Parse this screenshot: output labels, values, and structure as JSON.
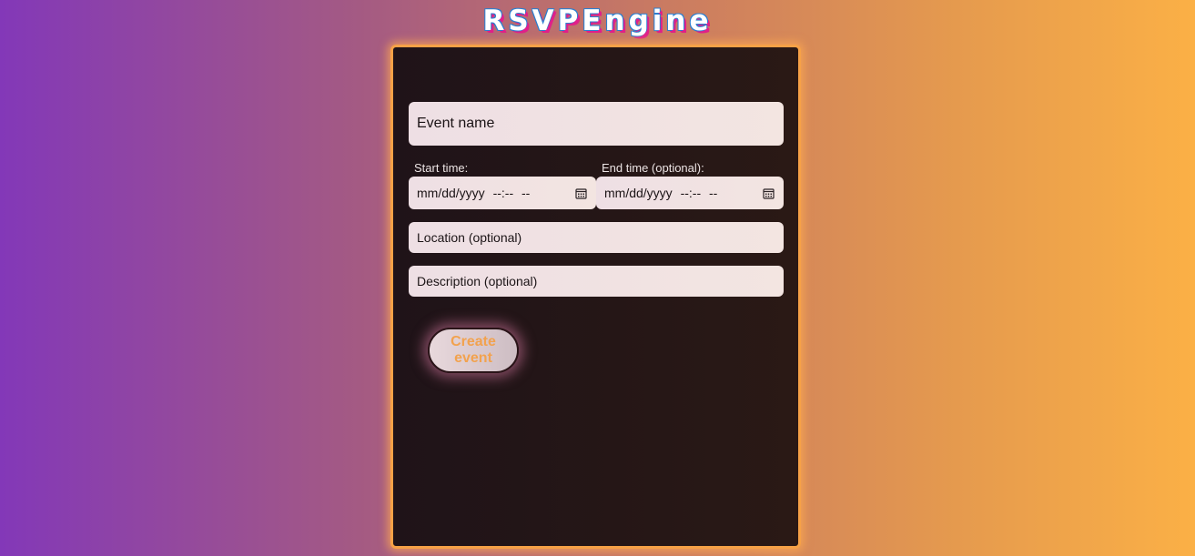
{
  "app": {
    "title": "RSVPEngine"
  },
  "form": {
    "event_name_placeholder": "Event name",
    "start_label": "Start time:",
    "end_label": "End time (optional):",
    "start_input": {
      "date_placeholder": "mm/dd/yyyy",
      "time_placeholder": "--:--",
      "ampm_placeholder": "--",
      "icon": "calendar-icon"
    },
    "end_input": {
      "date_placeholder": "mm/dd/yyyy",
      "time_placeholder": "--:--",
      "ampm_placeholder": "--",
      "icon": "calendar-icon"
    },
    "location_placeholder": "Location (optional)",
    "description_placeholder": "Description (optional)",
    "submit_label": "Create event"
  },
  "colors": {
    "accent": "#f6a147",
    "button_text": "#f2a24e",
    "card_bg": "#211418",
    "gradient_left": "#8338b8",
    "gradient_right": "#fbb046"
  }
}
